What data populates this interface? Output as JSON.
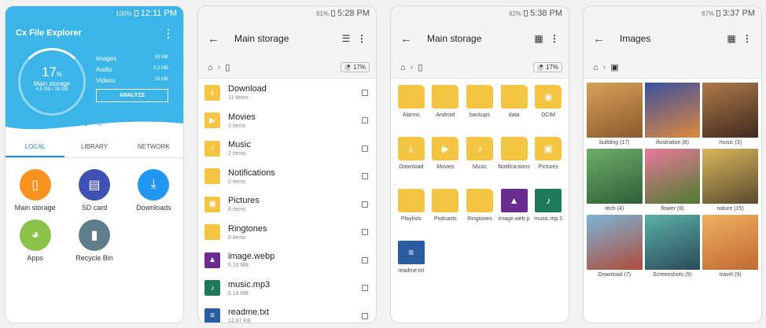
{
  "phone1": {
    "status": {
      "battery": "100%",
      "time": "12:11 PM"
    },
    "app_title": "Cx File Explorer",
    "storage": {
      "percent": "17",
      "percent_sign": "%",
      "label": "Main storage",
      "size": "4.5 GB / 26 GB"
    },
    "stats": [
      {
        "label": "Images",
        "value": "33 MB"
      },
      {
        "label": "Audio",
        "value": "2.2 MB"
      },
      {
        "label": "Videos",
        "value": "16 MB"
      }
    ],
    "analyze_label": "ANALYZE",
    "tabs": [
      "LOCAL",
      "LIBRARY",
      "NETWORK"
    ],
    "shortcuts": [
      {
        "label": "Main storage",
        "color": "#f7931e",
        "icon": "phone-icon"
      },
      {
        "label": "SD card",
        "color": "#3f51b5",
        "icon": "sd-card-icon"
      },
      {
        "label": "Downloads",
        "color": "#2196f3",
        "icon": "download-icon"
      },
      {
        "label": "Apps",
        "color": "#8bc34a",
        "icon": "android-icon"
      },
      {
        "label": "Recycle Bin",
        "color": "#607d8b",
        "icon": "trash-icon"
      }
    ]
  },
  "phone2": {
    "status": {
      "battery": "91%",
      "time": "5:28 PM"
    },
    "title": "Main storage",
    "usage": "17%",
    "items": [
      {
        "name": "Download",
        "sub": "11 items",
        "type": "folder",
        "glyph": "⤓",
        "color": "#f4c542",
        "icon": "download-folder-icon"
      },
      {
        "name": "Movies",
        "sub": "3 items",
        "type": "folder",
        "glyph": "▶",
        "color": "#f4c542",
        "icon": "movies-folder-icon"
      },
      {
        "name": "Music",
        "sub": "2 items",
        "type": "folder",
        "glyph": "♪",
        "color": "#f4c542",
        "icon": "music-folder-icon"
      },
      {
        "name": "Notifications",
        "sub": "0 items",
        "type": "folder",
        "glyph": "",
        "color": "#f4c542",
        "icon": "folder-icon"
      },
      {
        "name": "Pictures",
        "sub": "8 items",
        "type": "folder",
        "glyph": "▣",
        "color": "#f4c542",
        "icon": "pictures-folder-icon"
      },
      {
        "name": "Ringtones",
        "sub": "0 items",
        "type": "folder",
        "glyph": "",
        "color": "#f4c542",
        "icon": "folder-icon"
      },
      {
        "name": "image.webp",
        "sub": "6.18 MB",
        "type": "file",
        "glyph": "▲",
        "color": "#6a2c91",
        "icon": "image-file-icon"
      },
      {
        "name": "music.mp3",
        "sub": "6.18 MB",
        "type": "file",
        "glyph": "♪",
        "color": "#1e7a5a",
        "icon": "audio-file-icon"
      },
      {
        "name": "readme.txt",
        "sub": "12.87 KB",
        "type": "file",
        "glyph": "≡",
        "color": "#2a5d9f",
        "icon": "text-file-icon"
      }
    ]
  },
  "phone3": {
    "status": {
      "battery": "92%",
      "time": "5:38 PM"
    },
    "title": "Main storage",
    "usage": "17%",
    "items": [
      {
        "name": "Alarms",
        "type": "folder",
        "glyph": "",
        "color": "#f4c542",
        "icon": "folder-icon"
      },
      {
        "name": "Android",
        "type": "folder",
        "glyph": "",
        "color": "#f4c542",
        "icon": "folder-icon"
      },
      {
        "name": "backups",
        "type": "folder",
        "glyph": "",
        "color": "#f4c542",
        "icon": "folder-icon"
      },
      {
        "name": "data",
        "type": "folder",
        "glyph": "",
        "color": "#f4c542",
        "icon": "folder-icon"
      },
      {
        "name": "DCIM",
        "type": "folder",
        "glyph": "◉",
        "color": "#f4c542",
        "icon": "camera-folder-icon"
      },
      {
        "name": "Download",
        "type": "folder",
        "glyph": "⤓",
        "color": "#f4c542",
        "icon": "download-folder-icon"
      },
      {
        "name": "Movies",
        "type": "folder",
        "glyph": "▶",
        "color": "#f4c542",
        "icon": "movies-folder-icon"
      },
      {
        "name": "Music",
        "type": "folder",
        "glyph": "♪",
        "color": "#f4c542",
        "icon": "music-folder-icon"
      },
      {
        "name": "Notifica-tions",
        "type": "folder",
        "glyph": "",
        "color": "#f4c542",
        "icon": "folder-icon"
      },
      {
        "name": "Pictures",
        "type": "folder",
        "glyph": "▣",
        "color": "#f4c542",
        "icon": "pictures-folder-icon"
      },
      {
        "name": "Playlists",
        "type": "folder",
        "glyph": "",
        "color": "#f4c542",
        "icon": "folder-icon"
      },
      {
        "name": "Podcasts",
        "type": "folder",
        "glyph": "",
        "color": "#f4c542",
        "icon": "folder-icon"
      },
      {
        "name": "Ringtones",
        "type": "folder",
        "glyph": "",
        "color": "#f4c542",
        "icon": "folder-icon"
      },
      {
        "name": "image.web p",
        "type": "file",
        "glyph": "▲",
        "color": "#6a2c91",
        "icon": "image-file-icon"
      },
      {
        "name": "music.mp 3",
        "type": "file",
        "glyph": "♪",
        "color": "#1e7a5a",
        "icon": "audio-file-icon"
      },
      {
        "name": "readme.txt",
        "type": "file",
        "glyph": "≡",
        "color": "#2a5d9f",
        "icon": "text-file-icon"
      }
    ]
  },
  "phone4": {
    "status": {
      "battery": "87%",
      "time": "3:37 PM"
    },
    "title": "Images",
    "albums": [
      {
        "label": "building (17)",
        "colors": [
          "#d8a15a",
          "#8a5a2b"
        ]
      },
      {
        "label": "illustration (8)",
        "colors": [
          "#3a4fa0",
          "#e08a3c"
        ]
      },
      {
        "label": "music (3)",
        "colors": [
          "#b07a4a",
          "#3e2a1e"
        ]
      },
      {
        "label": "tech (4)",
        "colors": [
          "#6fae6a",
          "#2f5e36"
        ]
      },
      {
        "label": "flower (8)",
        "colors": [
          "#e87a9a",
          "#4e7a30"
        ]
      },
      {
        "label": "nature (15)",
        "colors": [
          "#d9b75a",
          "#5a4a30"
        ]
      },
      {
        "label": "Download (7)",
        "colors": [
          "#7ab6d8",
          "#b04a3a"
        ]
      },
      {
        "label": "Screenshots (5)",
        "colors": [
          "#5ab0a8",
          "#2b4a5a"
        ]
      },
      {
        "label": "travel (9)",
        "colors": [
          "#f0b060",
          "#c06a30"
        ]
      }
    ]
  }
}
